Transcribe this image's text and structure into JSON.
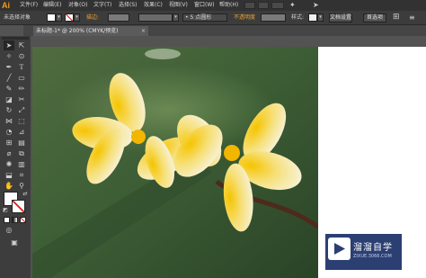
{
  "app": {
    "logo": "Ai"
  },
  "menu": {
    "items": [
      "文件(F)",
      "编辑(E)",
      "对象(O)",
      "文字(T)",
      "选择(S)",
      "效果(C)",
      "视图(V)",
      "窗口(W)",
      "帮助(H)"
    ]
  },
  "control_bar": {
    "selection_label": "未选择对象",
    "stroke_label": "描边:",
    "brush_value": "5 点圆形",
    "opacity_label": "不透明度",
    "style_label": "样式:",
    "doc_setup_button": "文档设置",
    "prefs_button": "首选项"
  },
  "document_tab": {
    "title": "未标题-1* @ 200% (CMYK/预览)",
    "close": "×"
  },
  "watermark": {
    "title": "溜溜自学",
    "url": "ZIXUE.3066.COM"
  },
  "colors": {
    "accent_orange": "#f29a1c",
    "panel": "#3d3d3d",
    "watermark_bg": "#2b3f73"
  }
}
